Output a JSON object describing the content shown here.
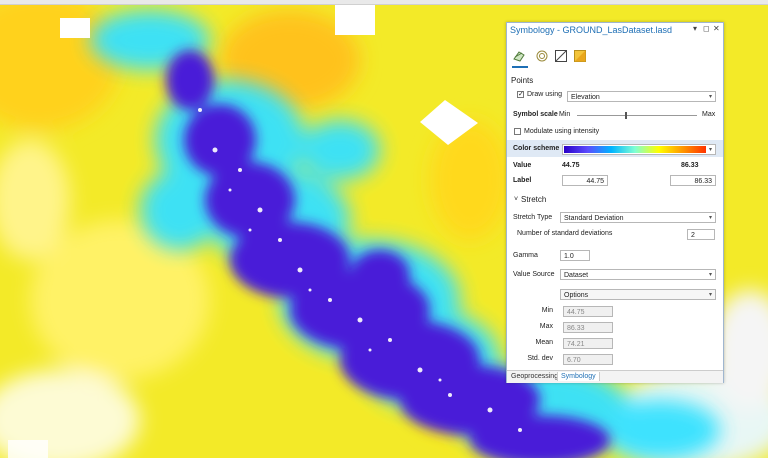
{
  "panel": {
    "title": "Symbology - GROUND_LasDataset.lasd",
    "pin_glyph": "▾ ◻ ✕",
    "section_points": "Points",
    "draw_using_label": "Draw using",
    "draw_using_checked": true,
    "draw_using_value": "Elevation",
    "symbol_scale_label": "Symbol scale",
    "symbol_scale_min": "Min",
    "symbol_scale_max": "Max",
    "symbol_scale_level": 0.4,
    "modulate_label": "Modulate using intensity",
    "modulate_checked": false,
    "color_scheme_label": "Color scheme",
    "value_label": "Value",
    "value_min": "44.75",
    "value_max": "86.33",
    "label_label": "Label",
    "label_min": "44.75",
    "label_max": "86.33",
    "section_stretch": "Stretch",
    "stretch_type_label": "Stretch Type",
    "stretch_type_value": "Standard Deviation",
    "num_std_label": "Number of standard deviations",
    "num_std_value": "2",
    "gamma_label": "Gamma",
    "gamma_value": "1.0",
    "value_source_label": "Value Source",
    "value_source_value": "Dataset",
    "options_label": "Options",
    "stats": [
      {
        "label": "Min",
        "value": "44.75"
      },
      {
        "label": "Max",
        "value": "86.33"
      },
      {
        "label": "Mean",
        "value": "74.21"
      },
      {
        "label": "Std. dev",
        "value": "6.70"
      }
    ],
    "bottom_tabs": [
      "Geoprocessing",
      "Symbology"
    ],
    "active_tab": "Symbology"
  },
  "icons": [
    "points-symbology-icon",
    "surface-icon",
    "lines-icon",
    "edges-icon"
  ],
  "colors": {
    "accent": "#1e6fb5",
    "ramp": [
      "#2a00c8",
      "#5a4cff",
      "#00b4ff",
      "#7fffd4",
      "#ffff00",
      "#ff9900",
      "#ff3300"
    ]
  }
}
